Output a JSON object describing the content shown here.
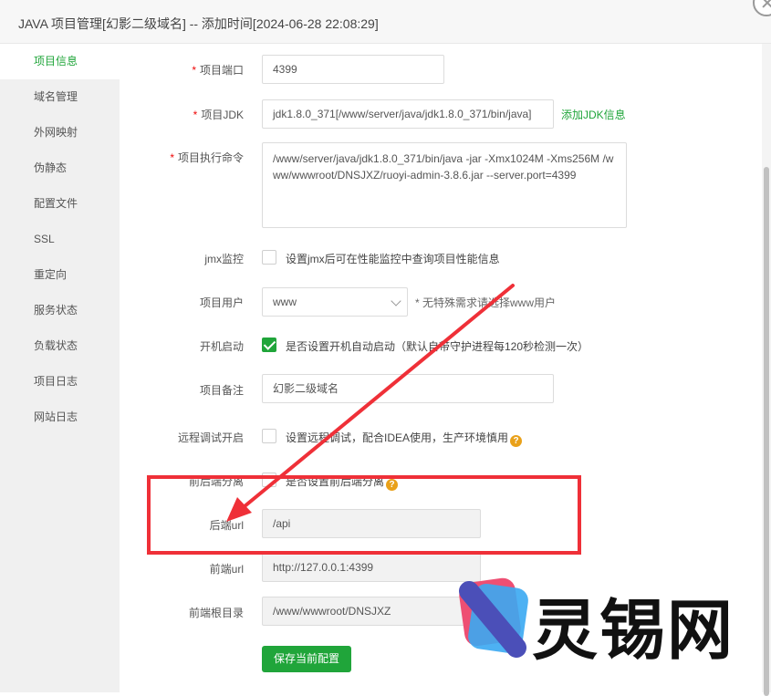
{
  "window": {
    "title": "JAVA 项目管理[幻影二级域名] -- 添加时间[2024-06-28 22:08:29]"
  },
  "sidebar": {
    "items": [
      {
        "label": "项目信息",
        "active": true
      },
      {
        "label": "域名管理"
      },
      {
        "label": "外网映射"
      },
      {
        "label": "伪静态"
      },
      {
        "label": "配置文件"
      },
      {
        "label": "SSL"
      },
      {
        "label": "重定向"
      },
      {
        "label": "服务状态"
      },
      {
        "label": "负载状态"
      },
      {
        "label": "项目日志"
      },
      {
        "label": "网站日志"
      }
    ]
  },
  "form": {
    "required_mark": "*",
    "port": {
      "label": "项目端口",
      "value": "4399"
    },
    "jdk": {
      "label": "项目JDK",
      "value": "jdk1.8.0_371[/www/server/java/jdk1.8.0_371/bin/java]",
      "add_link": "添加JDK信息"
    },
    "command": {
      "label": "项目执行命令",
      "value": "/www/server/java/jdk1.8.0_371/bin/java  -jar -Xmx1024M -Xms256M  /www/wwwroot/DNSJXZ/ruoyi-admin-3.8.6.jar --server.port=4399"
    },
    "jmx": {
      "label": "jmx监控",
      "text": "设置jmx后可在性能监控中查询项目性能信息",
      "checked": false
    },
    "user": {
      "label": "项目用户",
      "value": "www",
      "hint": "* 无特殊需求请选择www用户"
    },
    "autostart": {
      "label": "开机启动",
      "text": "是否设置开机自动启动（默认自带守护进程每120秒检测一次）",
      "checked": true
    },
    "remark": {
      "label": "项目备注",
      "value": "幻影二级域名"
    },
    "debug": {
      "label": "远程调试开启",
      "text": "设置远程调试，配合IDEA使用，生产环境慎用",
      "checked": false
    },
    "separation": {
      "label": "前后端分离",
      "text": "是否设置前后端分离",
      "checked": false
    },
    "backend_url": {
      "label": "后端url",
      "value": "/api"
    },
    "frontend_url": {
      "label": "前端url",
      "value": "http://127.0.0.1:4399"
    },
    "frontend_root": {
      "label": "前端根目录",
      "value": "/www/wwwroot/DNSJXZ"
    },
    "help_mark": "?",
    "save_label": "保存当前配置"
  },
  "watermark": {
    "text": "灵锡网"
  },
  "colors": {
    "accent": "#20a53a",
    "highlight": "#ef3038",
    "required": "#ef0808"
  }
}
